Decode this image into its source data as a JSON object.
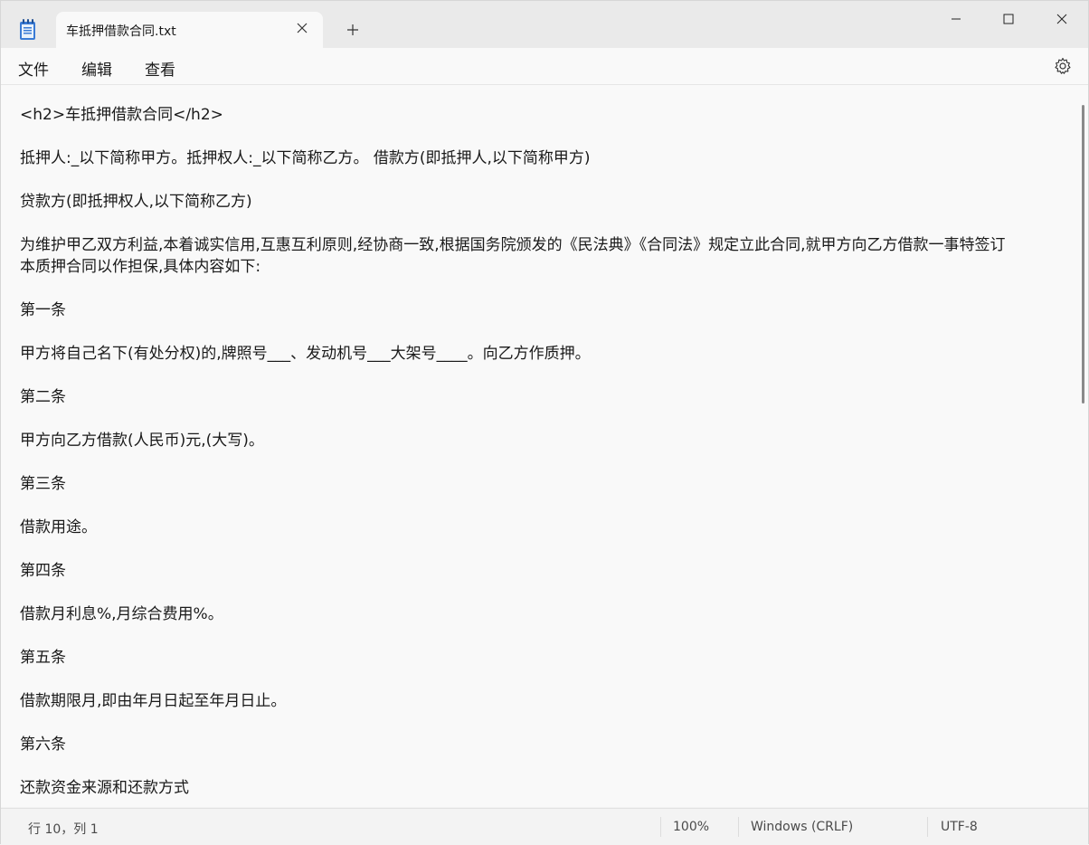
{
  "window": {
    "tab_title": "车抵押借款合同.txt",
    "new_tab_symbol": "+",
    "close_tab_symbol": "×"
  },
  "menu": {
    "file": "文件",
    "edit": "编辑",
    "view": "查看"
  },
  "document": {
    "lines": [
      "<h2>车抵押借款合同</h2>",
      "抵押人:_以下简称甲方。抵押权人:_以下简称乙方。 借款方(即抵押人,以下简称甲方)",
      "贷款方(即抵押权人,以下简称乙方)",
      "为维护甲乙双方利益,本着诚实信用,互惠互利原则,经协商一致,根据国务院颁发的《民法典》《合同法》规定立此合同,就甲方向乙方借款一事特签订",
      "本质押合同以作担保,具体内容如下:",
      "第一条",
      "甲方将自己名下(有处分权)的,牌照号___、发动机号___大架号____。向乙方作质押。",
      "第二条",
      "甲方向乙方借款(人民币)元,(大写)。",
      "第三条",
      "借款用途。",
      "第四条",
      "借款月利息%,月综合费用%。",
      "第五条",
      "借款期限月,即由年月日起至年月日止。",
      "第六条",
      "还款资金来源和还款方式"
    ]
  },
  "status": {
    "position": "行 10，列 1",
    "zoom": "100%",
    "line_ending": "Windows (CRLF)",
    "encoding": "UTF-8"
  }
}
